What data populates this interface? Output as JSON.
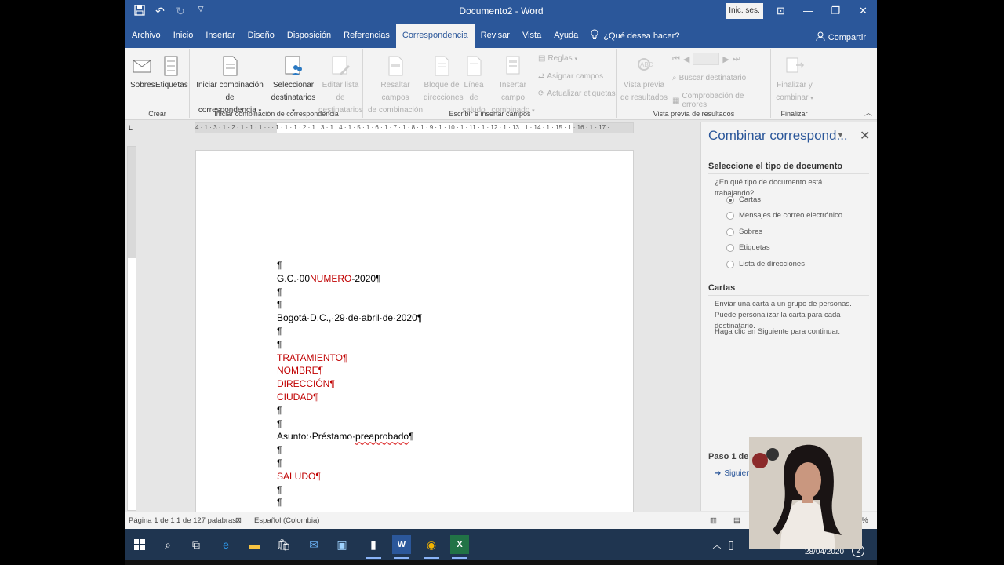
{
  "window": {
    "title": "Documento2 - Word",
    "sign_in": "Inic. ses."
  },
  "tabs": [
    "Archivo",
    "Inicio",
    "Insertar",
    "Diseño",
    "Disposición",
    "Referencias",
    "Correspondencia",
    "Revisar",
    "Vista",
    "Ayuda"
  ],
  "active_tab": "Correspondencia",
  "tell_me": "¿Qué desea hacer?",
  "share": "Compartir",
  "ribbon": {
    "crear": {
      "label": "Crear",
      "sobres": "Sobres",
      "etiquetas": "Etiquetas"
    },
    "iniciar": {
      "label": "Iniciar combinación de correspondencia",
      "iniciar_l1": "Iniciar combinación de",
      "iniciar_l2": "correspondencia",
      "seleccionar_l1": "Seleccionar",
      "seleccionar_l2": "destinatarios",
      "editar_l1": "Editar lista de",
      "editar_l2": "destinatarios"
    },
    "escribir": {
      "label": "Escribir e insertar campos",
      "resaltar_l1": "Resaltar campos",
      "resaltar_l2": "de combinación",
      "bloque_l1": "Bloque de",
      "bloque_l2": "direcciones",
      "linea_l1": "Línea de",
      "linea_l2": "saludo",
      "insertar_l1": "Insertar campo",
      "insertar_l2": "combinado",
      "reglas": "Reglas",
      "asignar": "Asignar campos",
      "actualizar": "Actualizar etiquetas"
    },
    "vista": {
      "label": "Vista previa de resultados",
      "vista_l1": "Vista previa",
      "vista_l2": "de resultados",
      "buscar": "Buscar destinatario",
      "comprobacion": "Comprobación de errores"
    },
    "finalizar": {
      "label": "Finalizar",
      "fin_l1": "Finalizar y",
      "fin_l2": "combinar"
    }
  },
  "ruler": "4 · 1 · 3 · 1 · 2 · 1 · 1 · 1 · · · 1 · 1 · 1 · 2 · 1 · 3 · 1 · 4 · 1 · 5 · 1 · 6 · 1 · 7 · 1 · 8 · 1 · 9 · 1 · 10 · 1 · 11 · 1 · 12 · 1 · 13 · 1 · 14 · 1 · 15 · 1 · 16 · 1 · 17 ·",
  "document": {
    "p1": "¶",
    "gc_prefix": "G.C.·00",
    "gc_field": "NUMERO",
    "gc_suffix": "-2020¶",
    "p3": "¶",
    "p4": "¶",
    "date": "Bogotá·D.C.,·29·de·abril·de·2020¶",
    "p6": "¶",
    "p7": "¶",
    "tratamiento": "TRATAMIENTO¶",
    "nombre": "NOMBRE¶",
    "direccion": "DIRECCIÓN¶",
    "ciudad": "CIUDAD¶",
    "p12": "¶",
    "p13": "¶",
    "asunto_prefix": "Asunto:·Préstamo·",
    "asunto_word": "preaprobado",
    "asunto_mark": "¶",
    "p15": "¶",
    "p16": "¶",
    "saludo": "SALUDO¶",
    "p18": "¶",
    "p19": "¶"
  },
  "task_pane": {
    "title": "Combinar correspond...",
    "section1": "Seleccione el tipo de documento",
    "question": "¿En qué tipo de documento está trabajando?",
    "options": [
      "Cartas",
      "Mensajes de correo electrónico",
      "Sobres",
      "Etiquetas",
      "Lista de direcciones"
    ],
    "selected": "Cartas",
    "section2": "Cartas",
    "desc": "Enviar una carta a un grupo de personas. Puede personalizar la carta para cada destinatario.",
    "hint": "Haga clic en Siguiente para continuar.",
    "step": "Paso 1 de 6",
    "next": "Siguiente"
  },
  "status": {
    "page": "Página 1 de 1",
    "words": "1 de 127 palabras",
    "language": "Español (Colombia)",
    "zoom": "2%"
  },
  "taskbar": {
    "date": "28/04/2020",
    "badge": "2"
  }
}
